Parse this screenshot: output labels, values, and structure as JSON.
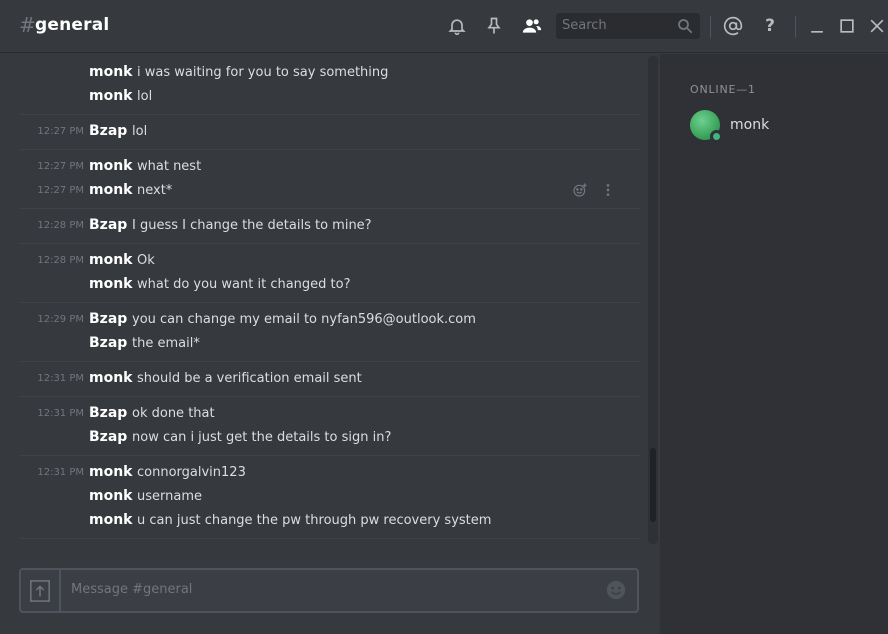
{
  "header": {
    "hash": "#",
    "channel": "general",
    "search_placeholder": "Search"
  },
  "icons": {
    "bell": "bell-icon",
    "pin": "pin-icon",
    "members": "members-icon",
    "search": "search-icon",
    "mention": "mention-icon",
    "help": "help-icon",
    "minimize": "minimize-icon",
    "maximize": "maximize-icon",
    "close": "close-icon"
  },
  "messages": [
    {
      "rows": [
        {
          "ts": "",
          "author": "monk",
          "text": "i was waiting for you to say something"
        },
        {
          "ts": "",
          "author": "monk",
          "text": "lol"
        }
      ]
    },
    {
      "rows": [
        {
          "ts": "12:27 PM",
          "author": "Bzap",
          "text": "lol"
        }
      ]
    },
    {
      "rows": [
        {
          "ts": "12:27 PM",
          "author": "monk",
          "text": "what nest"
        },
        {
          "ts": "12:27 PM",
          "author": "monk",
          "text": "next*"
        }
      ]
    },
    {
      "rows": [
        {
          "ts": "12:28 PM",
          "author": "Bzap",
          "text": "I guess I change the details to mine?"
        }
      ]
    },
    {
      "rows": [
        {
          "ts": "12:28 PM",
          "author": "monk",
          "text": "Ok"
        },
        {
          "ts": "",
          "author": "monk",
          "text": "what do you want it changed to?"
        }
      ]
    },
    {
      "rows": [
        {
          "ts": "12:29 PM",
          "author": "Bzap",
          "text": "you can change my email to nyfan596@outlook.com"
        },
        {
          "ts": "",
          "author": "Bzap",
          "text": "the email*"
        }
      ]
    },
    {
      "rows": [
        {
          "ts": "12:31 PM",
          "author": "monk",
          "text": "should be a verification email sent"
        }
      ]
    },
    {
      "rows": [
        {
          "ts": "12:31 PM",
          "author": "Bzap",
          "text": "ok done that"
        },
        {
          "ts": "",
          "author": "Bzap",
          "text": "now can i just get the details to sign in?"
        }
      ]
    },
    {
      "rows": [
        {
          "ts": "12:31 PM",
          "author": "monk",
          "text": "connorgalvin123"
        },
        {
          "ts": "",
          "author": "monk",
          "text": "username"
        },
        {
          "ts": "",
          "author": "monk",
          "text": "u can just change the pw through pw recovery system"
        }
      ]
    }
  ],
  "composer": {
    "placeholder": "Message #general"
  },
  "members": {
    "heading": "ONLINE—1",
    "list": [
      {
        "name": "monk",
        "status": "online",
        "status_color": "#43b581"
      }
    ]
  },
  "colors": {
    "background": "#36393e",
    "sidebar": "#2f3136",
    "online": "#43b581"
  }
}
